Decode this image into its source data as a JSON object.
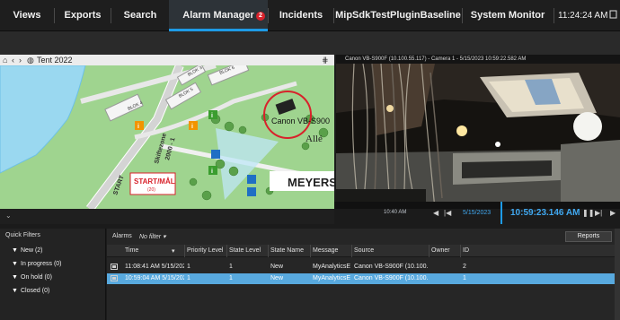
{
  "nav": {
    "tabs": [
      {
        "label": "Views"
      },
      {
        "label": "Exports"
      },
      {
        "label": "Search"
      },
      {
        "label": "Alarm Manager",
        "badge": "2",
        "active": true
      },
      {
        "label": "Incidents"
      },
      {
        "label": "MipSdkTestPluginBaseline"
      },
      {
        "label": "System Monitor"
      }
    ],
    "clock": "11:24:24 AM",
    "accent": "#1e9be6",
    "badge_color": "#d8222b"
  },
  "map": {
    "title": "Tent 2022",
    "labels": {
      "camera": "Canon VB-S900",
      "start": "START/MÅL",
      "start_sub": "(20)",
      "skifte": "Skiftezone",
      "skifte_sub": "2000 - 1",
      "start_side": "START",
      "meyers": "MEYERS",
      "alle": "Allé",
      "blok4": "BLOK 4",
      "blok5": "BLOK 5",
      "blok3": "BLOK 3",
      "blok6": "BLOK 6"
    }
  },
  "camera": {
    "title": "Canon VB-S900F (10.100.55.117) - Camera 1 - 5/15/2023 10:59:22.582 AM"
  },
  "timeline": {
    "tick": "10:40 AM",
    "date": "5/15/2023",
    "time": "10:59:23.146 AM"
  },
  "quick_filters": {
    "title": "Quick Filters",
    "items": [
      "New (2)",
      "In progress (0)",
      "On hold (0)",
      "Closed (0)"
    ]
  },
  "alarms": {
    "title": "Alarms",
    "filter": "No filter",
    "reports_label": "Reports",
    "columns": [
      "Time",
      "Priority Level",
      "State Level",
      "State Name",
      "Message",
      "Source",
      "Owner",
      "ID"
    ],
    "rows": [
      {
        "time": "11:08:41 AM 5/15/202",
        "priority": "1",
        "state_level": "1",
        "state_name": "New",
        "message": "MyAnalyticsE",
        "source": "Canon VB-S900F (10.100.5",
        "owner": "",
        "id": "2"
      },
      {
        "time": "10:59:04 AM 5/15/202",
        "priority": "1",
        "state_level": "1",
        "state_name": "New",
        "message": "MyAnalyticsE",
        "source": "Canon VB-S900F (10.100.5",
        "owner": "",
        "id": "1",
        "selected": true
      }
    ]
  }
}
